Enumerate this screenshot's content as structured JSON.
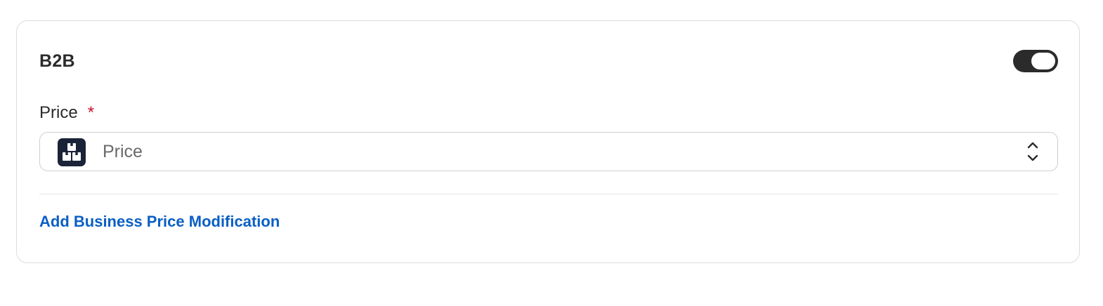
{
  "card": {
    "title": "B2B",
    "toggle": {
      "state": "on",
      "accent_color": "#2b2b2b"
    }
  },
  "price_field": {
    "label": "Price",
    "required_marker": "*",
    "required_color": "#c4132d",
    "select": {
      "icon": "boxes-icon",
      "value": "Price",
      "chevron_icon": "chevron-up-down-icon"
    }
  },
  "actions": {
    "add_modification_label": "Add Business Price Modification",
    "link_color": "#0a5fc4"
  }
}
